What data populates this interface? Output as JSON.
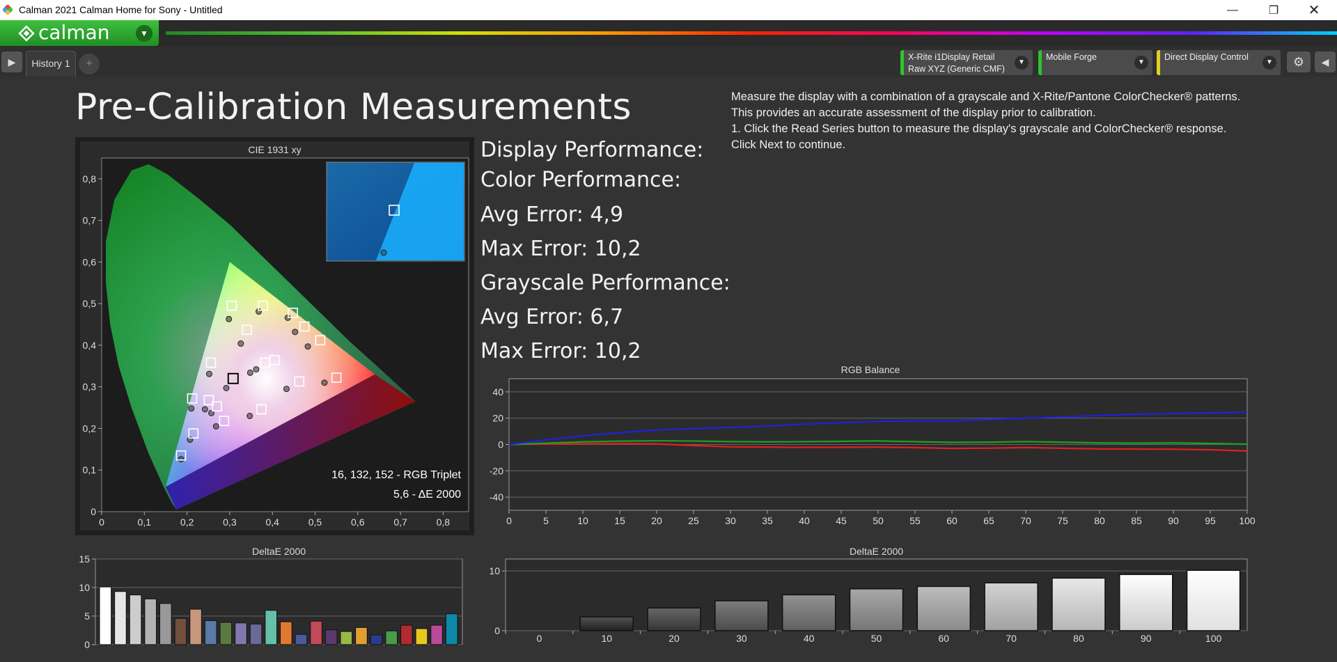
{
  "window": {
    "title": "Calman 2021 Calman Home for Sony  - Untitled",
    "minimize_icon": "minimize-icon",
    "maximize_icon": "restore-icon",
    "close_icon": "close-icon"
  },
  "brand": {
    "name": "calman"
  },
  "tabs": [
    {
      "label": "History 1"
    }
  ],
  "devices": [
    {
      "line1": "X-Rite i1Display Retail",
      "line2": "Raw XYZ (Generic CMF)",
      "color": "#2ec42e"
    },
    {
      "line1": "Mobile Forge",
      "line2": "",
      "color": "#2ec42e"
    },
    {
      "line1": "Direct Display Control",
      "line2": "",
      "color": "#e0d020"
    }
  ],
  "page": {
    "title": "Pre-Calibration Measurements",
    "instructions": [
      "Measure the display with a combination of a grayscale and X-Rite/Pantone ColorChecker® patterns.",
      "This provides an accurate assessment of the display prior to calibration.",
      "1. Click the Read Series button to measure the display's grayscale and ColorChecker® response.",
      "Click Next to continue."
    ]
  },
  "performance": {
    "display_label": "Display Performance:",
    "color_label": "Color Performance:",
    "color_avg": "Avg Error: 4,9",
    "color_max": "Max Error: 10,2",
    "gray_label": "Grayscale Performance:",
    "gray_avg": "Avg Error: 6,7",
    "gray_max": "Max Error: 10,2"
  },
  "cie": {
    "title": "CIE 1931 xy",
    "readout_rgb": "16, 132, 152 - RGB Triplet",
    "readout_de": "5,6 - ΔE 2000",
    "x_ticks": [
      "0",
      "0,1",
      "0,2",
      "0,3",
      "0,4",
      "0,5",
      "0,6",
      "0,7",
      "0,8"
    ],
    "y_ticks": [
      "0",
      "0,1",
      "0,2",
      "0,3",
      "0,4",
      "0,5",
      "0,6",
      "0,7",
      "0,8"
    ],
    "gamut": [
      [
        0.64,
        0.33
      ],
      [
        0.3,
        0.6
      ],
      [
        0.15,
        0.06
      ]
    ],
    "targets": [
      [
        0.212,
        0.272
      ],
      [
        0.305,
        0.495
      ],
      [
        0.378,
        0.495
      ],
      [
        0.448,
        0.478
      ],
      [
        0.475,
        0.445
      ],
      [
        0.34,
        0.437
      ],
      [
        0.256,
        0.358
      ],
      [
        0.383,
        0.358
      ],
      [
        0.405,
        0.364
      ],
      [
        0.512,
        0.412
      ],
      [
        0.55,
        0.322
      ],
      [
        0.463,
        0.313
      ],
      [
        0.308,
        0.32
      ],
      [
        0.251,
        0.268
      ],
      [
        0.27,
        0.253
      ],
      [
        0.374,
        0.246
      ],
      [
        0.287,
        0.218
      ],
      [
        0.215,
        0.188
      ],
      [
        0.186,
        0.135
      ]
    ],
    "measured": [
      [
        0.21,
        0.248
      ],
      [
        0.298,
        0.463
      ],
      [
        0.368,
        0.481
      ],
      [
        0.436,
        0.466
      ],
      [
        0.453,
        0.432
      ],
      [
        0.326,
        0.404
      ],
      [
        0.252,
        0.331
      ],
      [
        0.362,
        0.342
      ],
      [
        0.348,
        0.334
      ],
      [
        0.483,
        0.397
      ],
      [
        0.522,
        0.31
      ],
      [
        0.433,
        0.295
      ],
      [
        0.292,
        0.297
      ],
      [
        0.242,
        0.246
      ],
      [
        0.257,
        0.237
      ],
      [
        0.347,
        0.23
      ],
      [
        0.268,
        0.205
      ],
      [
        0.207,
        0.173
      ],
      [
        0.186,
        0.126
      ]
    ],
    "inset_target": [
      0.305,
      0.32
    ],
    "inset_measured": [
      0.298,
      0.305
    ]
  },
  "chart_data": [
    {
      "type": "line",
      "title": "RGB Balance",
      "x": [
        0,
        5,
        10,
        15,
        20,
        25,
        30,
        35,
        40,
        45,
        50,
        55,
        60,
        65,
        70,
        75,
        80,
        85,
        90,
        95,
        100
      ],
      "xlim": [
        0,
        100
      ],
      "ylim": [
        -50,
        50
      ],
      "y_ticks": [
        40,
        20,
        0,
        -20,
        -40
      ],
      "series": [
        {
          "color": "#e02020",
          "values": [
            0,
            0.3,
            0.5,
            0.6,
            0.4,
            -0.8,
            -1.8,
            -2,
            -2.2,
            -2.1,
            -2,
            -2.4,
            -3,
            -2.8,
            -2.3,
            -2.9,
            -3.4,
            -3.5,
            -3.6,
            -4,
            -5
          ]
        },
        {
          "color": "#20a020",
          "values": [
            0,
            1,
            2,
            2.5,
            2.8,
            2.6,
            2.2,
            2,
            2.1,
            2.4,
            2.7,
            2.1,
            1.6,
            1.7,
            2.2,
            1.7,
            1.2,
            1,
            1.2,
            0.8,
            0.2
          ]
        },
        {
          "color": "#2020e0",
          "values": [
            0,
            3.5,
            6.5,
            9,
            11,
            12,
            13,
            14,
            15.5,
            16.5,
            17.5,
            18,
            18,
            19,
            20,
            21,
            22,
            23,
            23.5,
            24,
            24.5
          ]
        }
      ]
    },
    {
      "type": "bar",
      "title": "DeltaE 2000",
      "ylim": [
        0,
        15
      ],
      "y_ticks": [
        0,
        5,
        10,
        15
      ],
      "values": [
        10.1,
        9.3,
        8.7,
        8.0,
        7.2,
        4.6,
        6.2,
        4.2,
        3.9,
        3.8,
        3.6,
        6.0,
        4.0,
        1.8,
        4.1,
        2.6,
        2.3,
        3.0,
        1.7,
        2.4,
        3.4,
        2.8,
        3.4,
        5.4
      ],
      "colors": [
        "#ffffff",
        "#e6e6e6",
        "#cccccc",
        "#b3b3b3",
        "#999999",
        "#70503c",
        "#c8967a",
        "#5a7aa8",
        "#5a7a40",
        "#8078b0",
        "#6a6a98",
        "#66c0a8",
        "#e07830",
        "#4a5a9c",
        "#c04a58",
        "#5a3a6a",
        "#98b848",
        "#e0a030",
        "#2e3a8a",
        "#4a9a48",
        "#b02a30",
        "#e8c820",
        "#b84a98",
        "#0a8aa8"
      ]
    },
    {
      "type": "bar",
      "title": "DeltaE 2000",
      "categories": [
        "0",
        "10",
        "20",
        "30",
        "40",
        "50",
        "60",
        "70",
        "80",
        "90",
        "100"
      ],
      "values": [
        0,
        2.3,
        3.8,
        5.0,
        6.0,
        7.0,
        7.4,
        8.0,
        8.8,
        9.4,
        10.1
      ],
      "ylim": [
        0,
        12
      ],
      "y_ticks": [
        0,
        10
      ]
    }
  ]
}
